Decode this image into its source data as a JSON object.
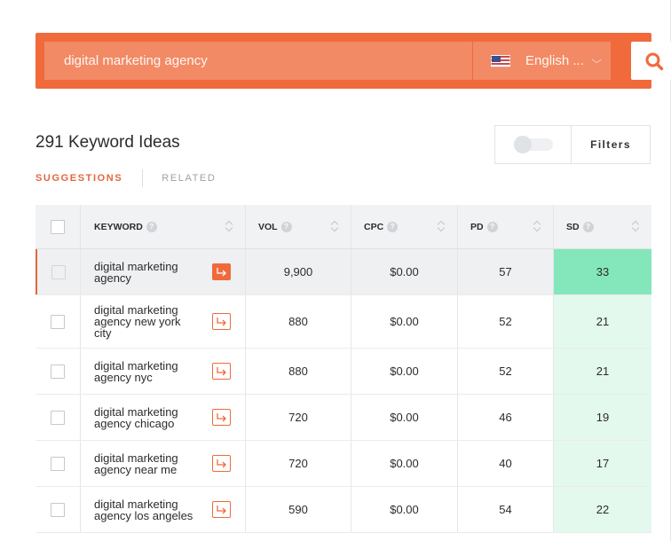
{
  "search": {
    "query": "digital marketing agency",
    "language": "English ...",
    "language_icon": "us-flag-icon",
    "submit_icon": "search-icon"
  },
  "heading": {
    "title": "291 Keyword Ideas",
    "tabs": [
      {
        "label": "SUGGESTIONS",
        "active": true
      },
      {
        "label": "RELATED",
        "active": false
      }
    ],
    "filters_label": "Filters",
    "toggle_on": false
  },
  "table": {
    "columns": [
      "KEYWORD",
      "VOL",
      "CPC",
      "PD",
      "SD"
    ],
    "rows": [
      {
        "keyword": "digital marketing agency",
        "vol": "9,900",
        "cpc": "$0.00",
        "pd": "57",
        "sd": "33"
      },
      {
        "keyword": "digital marketing agency new york city",
        "vol": "880",
        "cpc": "$0.00",
        "pd": "52",
        "sd": "21"
      },
      {
        "keyword": "digital marketing agency nyc",
        "vol": "880",
        "cpc": "$0.00",
        "pd": "52",
        "sd": "21"
      },
      {
        "keyword": "digital marketing agency chicago",
        "vol": "720",
        "cpc": "$0.00",
        "pd": "46",
        "sd": "19"
      },
      {
        "keyword": "digital marketing agency near me",
        "vol": "720",
        "cpc": "$0.00",
        "pd": "40",
        "sd": "17"
      },
      {
        "keyword": "digital marketing agency los angeles",
        "vol": "590",
        "cpc": "$0.00",
        "pd": "54",
        "sd": "22"
      }
    ]
  },
  "colors": {
    "accent": "#f06a3c",
    "sd_easy": "#e3f9ee",
    "sd_selected": "#84e7bc"
  }
}
